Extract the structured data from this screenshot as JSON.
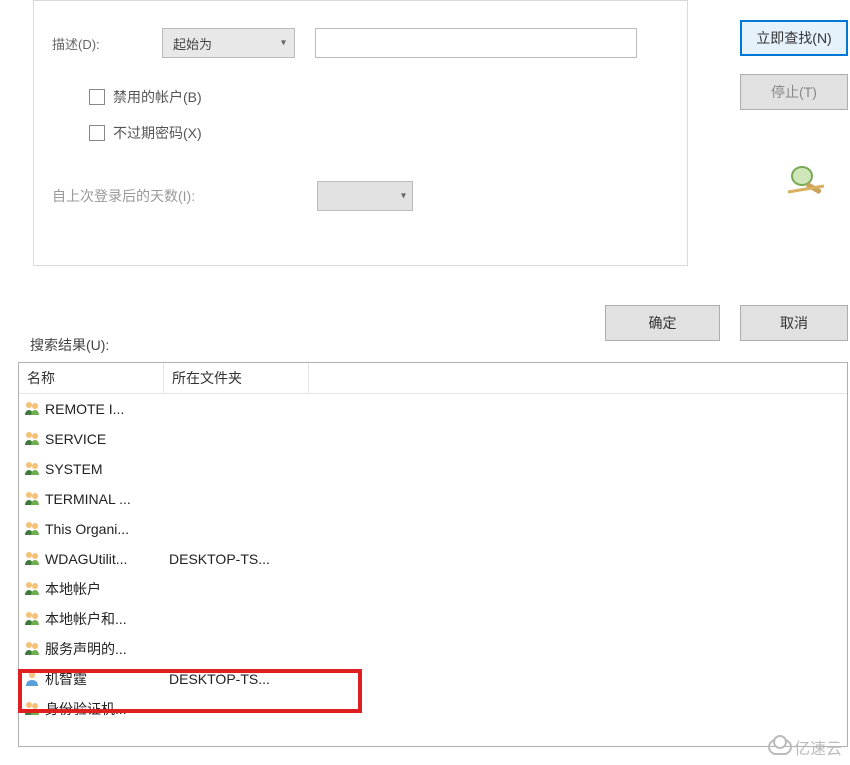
{
  "form": {
    "description_label": "描述(D):",
    "description_combo": "起始为",
    "disabled_accounts_label": "禁用的帐户(B)",
    "nonexpiring_pw_label": "不过期密码(X)",
    "days_since_login_label": "自上次登录后的天数(I):"
  },
  "buttons": {
    "find_now": "立即查找(N)",
    "stop": "停止(T)",
    "ok": "确定",
    "cancel": "取消"
  },
  "results_label": "搜索结果(U):",
  "columns": {
    "name": "名称",
    "folder": "所在文件夹"
  },
  "rows": [
    {
      "icon": "group",
      "name": "REMOTE I...",
      "folder": ""
    },
    {
      "icon": "group",
      "name": "SERVICE",
      "folder": ""
    },
    {
      "icon": "group",
      "name": "SYSTEM",
      "folder": ""
    },
    {
      "icon": "group",
      "name": "TERMINAL ...",
      "folder": ""
    },
    {
      "icon": "group",
      "name": "This Organi...",
      "folder": ""
    },
    {
      "icon": "group",
      "name": "WDAGUtilit...",
      "folder": "DESKTOP-TS..."
    },
    {
      "icon": "group",
      "name": "本地帐户",
      "folder": ""
    },
    {
      "icon": "group",
      "name": "本地帐户和...",
      "folder": ""
    },
    {
      "icon": "group",
      "name": "服务声明的...",
      "folder": ""
    },
    {
      "icon": "user",
      "name": "机智霆",
      "folder": "DESKTOP-TS..."
    },
    {
      "icon": "group",
      "name": "身份验证机...",
      "folder": ""
    }
  ],
  "watermark": "亿速云"
}
